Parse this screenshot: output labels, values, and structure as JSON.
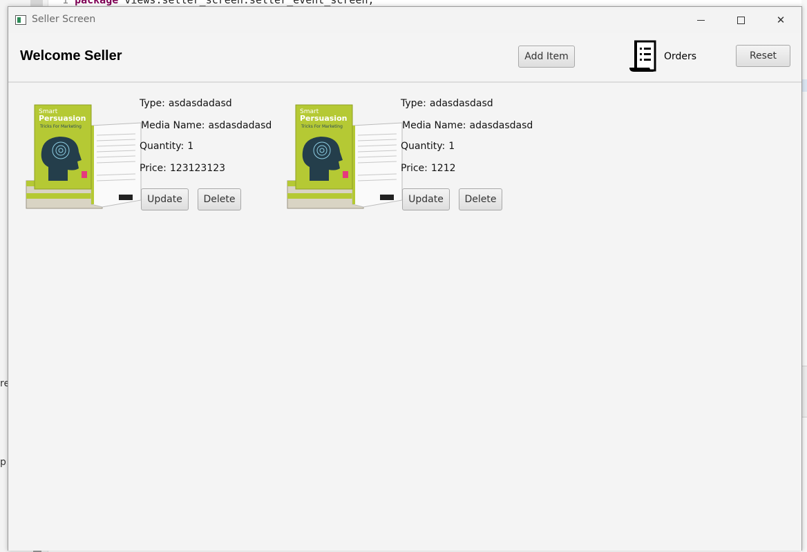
{
  "background": {
    "line_number": "1",
    "code_keyword": "package",
    "code_rest": " views.seller_screen.seller_event_screen;",
    "side_text_1": "re",
    "side_text_2": "p"
  },
  "window": {
    "title": "Seller Screen",
    "minimize_glyph": "—",
    "close_glyph": "✕"
  },
  "header": {
    "welcome": "Welcome Seller",
    "add_item_label": "Add Item",
    "orders_label": "Orders",
    "reset_label": "Reset"
  },
  "book_cover": {
    "title_small": "Smart",
    "title_big": "Persuasion",
    "subtitle": "Tricks For Marketing"
  },
  "items": [
    {
      "type_label": "Type:",
      "type_value": "asdasdadasd",
      "media_label": "Media Name:",
      "media_value": "asdasdadasd",
      "quantity_label": "Quantity:",
      "quantity_value": "1",
      "price_label": "Price:",
      "price_value": "123123123",
      "update_label": "Update",
      "delete_label": "Delete"
    },
    {
      "type_label": "Type:",
      "type_value": "adasdasdasd",
      "media_label": "Media Name:",
      "media_value": "adasdasdasd",
      "quantity_label": "Quantity:",
      "quantity_value": "1",
      "price_label": "Price:",
      "price_value": "1212",
      "update_label": "Update",
      "delete_label": "Delete"
    }
  ],
  "colors": {
    "window_bg": "#f4f4f4",
    "book_cover": "#b5c934",
    "keyword": "#7f0055"
  }
}
